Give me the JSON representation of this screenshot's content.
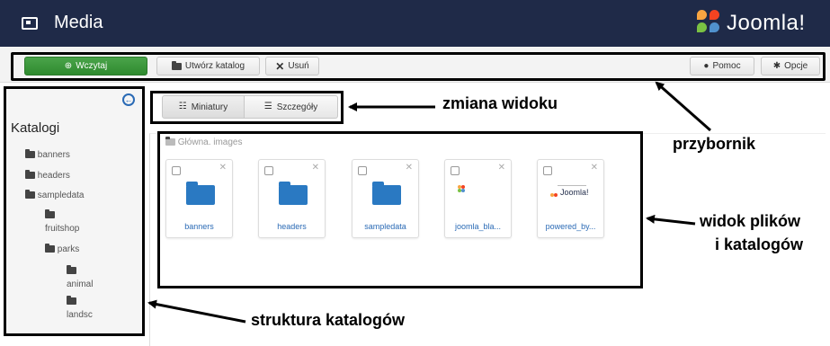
{
  "header": {
    "title": "Media",
    "logo_text": "Joomla!",
    "background": "#1f2a48"
  },
  "toolbar": {
    "upload_label": "Wczytaj",
    "create_folder_label": "Utwórz katalog",
    "delete_label": "Usuń",
    "help_label": "Pomoc",
    "options_label": "Opcje",
    "upload_color": "#3b9a3b"
  },
  "view_switch": {
    "thumbnails_label": "Miniatury",
    "details_label": "Szczegóły"
  },
  "sidebar": {
    "title": "Katalogi",
    "tree": [
      {
        "label": "banners",
        "level": 0
      },
      {
        "label": "headers",
        "level": 0
      },
      {
        "label": "sampledata",
        "level": 0
      },
      {
        "label": "fruitshop",
        "level": 1
      },
      {
        "label": "parks",
        "level": 1
      },
      {
        "label": "animal",
        "level": 2
      },
      {
        "label": "landsc",
        "level": 2
      }
    ]
  },
  "main": {
    "breadcrumb": "Główna. images",
    "items": [
      {
        "label": "banners",
        "type": "folder"
      },
      {
        "label": "headers",
        "type": "folder"
      },
      {
        "label": "sampledata",
        "type": "folder"
      },
      {
        "label": "joomla_bla...",
        "type": "image"
      },
      {
        "label": "powered_by...",
        "type": "image"
      }
    ],
    "powered_logo_text": "Joomla!"
  },
  "annotations": {
    "view_change": "zmiana widoku",
    "toolbar": "przybornik",
    "files_view_line1": "widok plików",
    "files_view_line2": "i katalogów",
    "folder_structure": "struktura katalogów"
  },
  "icons": {
    "media": "media-icon",
    "upload": "plus-circle-icon",
    "create_folder": "folder-icon",
    "delete": "x-icon",
    "help": "question-circle-icon",
    "options": "gear-icon",
    "collapse": "arrow-left-circle-icon",
    "thumbnails": "grid-icon",
    "details": "list-icon"
  }
}
